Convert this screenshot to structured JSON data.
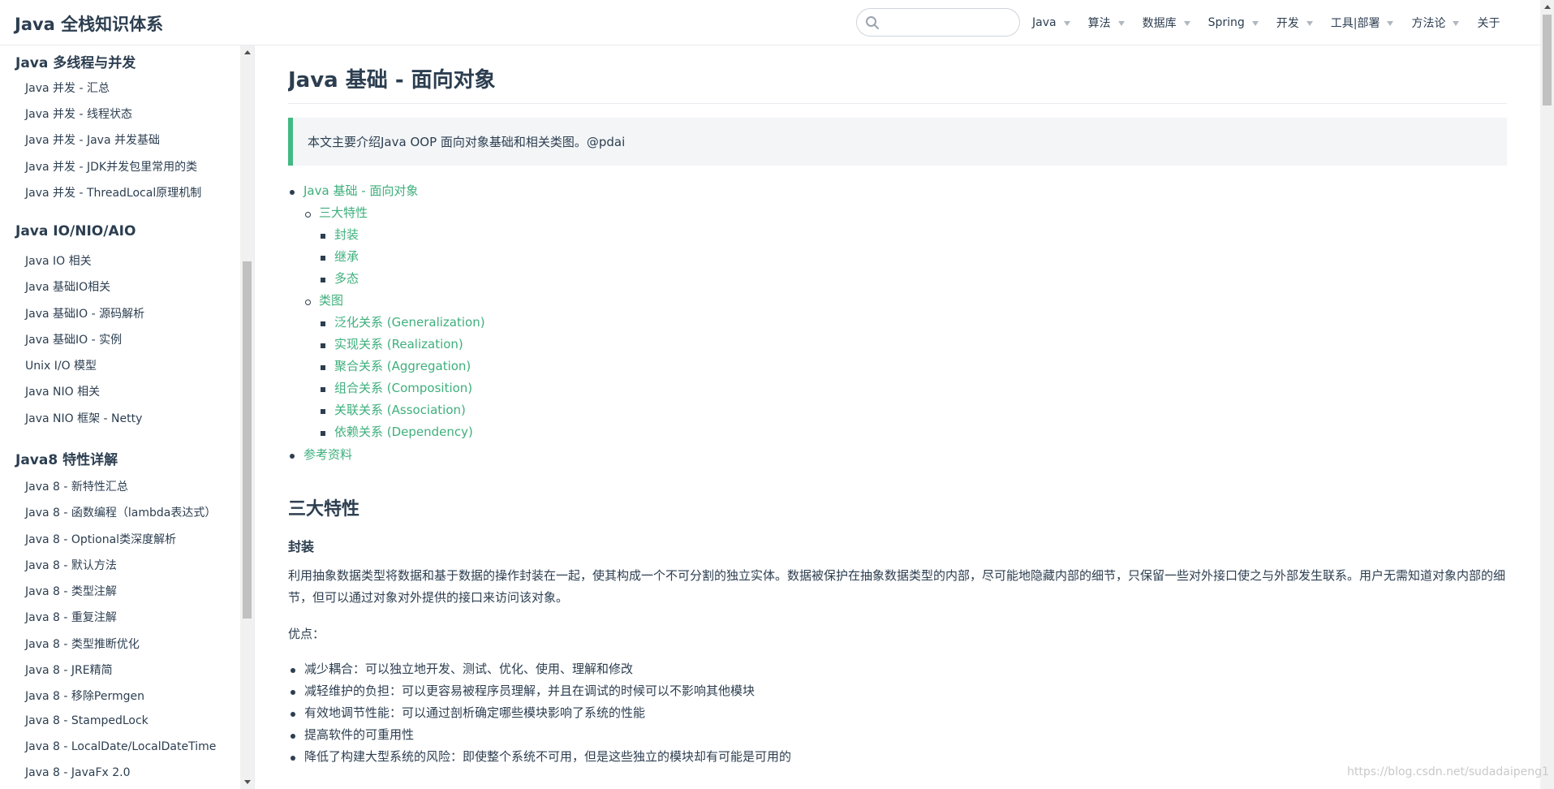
{
  "navbar": {
    "site_name": "Java 全栈知识体系",
    "search_value": "",
    "links": [
      {
        "label": "Java",
        "dropdown": true
      },
      {
        "label": "算法",
        "dropdown": true
      },
      {
        "label": "数据库",
        "dropdown": true
      },
      {
        "label": "Spring",
        "dropdown": true
      },
      {
        "label": "开发",
        "dropdown": true
      },
      {
        "label": "工具|部署",
        "dropdown": true
      },
      {
        "label": "方法论",
        "dropdown": true
      },
      {
        "label": "关于",
        "dropdown": false
      }
    ]
  },
  "sidebar": {
    "groups": [
      {
        "title": "Java 多线程与并发",
        "items": [
          "Java 并发 - 汇总",
          "Java 并发 - 线程状态",
          "Java 并发 - Java 并发基础",
          "Java 并发 - JDK并发包里常用的类",
          "Java 并发 - ThreadLocal原理机制"
        ]
      },
      {
        "title": "Java IO/NIO/AIO",
        "items": [
          "Java IO 相关",
          "Java 基础IO相关",
          "Java 基础IO - 源码解析",
          "Java 基础IO - 实例",
          "Unix I/O 模型",
          "Java NIO 相关",
          "Java NIO 框架 - Netty"
        ]
      },
      {
        "title": "Java8 特性详解",
        "items": [
          "Java 8 - 新特性汇总",
          "Java 8 - 函数编程（lambda表达式）",
          "Java 8 - Optional类深度解析",
          "Java 8 - 默认方法",
          "Java 8 - 类型注解",
          "Java 8 - 重复注解",
          "Java 8 - 类型推断优化",
          "Java 8 - JRE精简",
          "Java 8 - 移除Permgen",
          "Java 8 - StampedLock",
          "Java 8 - LocalDate/LocalDateTime",
          "Java 8 - JavaFx 2.0"
        ]
      }
    ]
  },
  "main": {
    "title": "Java 基础 - 面向对象",
    "tip": "本文主要介绍Java OOP 面向对象基础和相关类图。@pdai",
    "toc": [
      {
        "level": 1,
        "label": "Java 基础 - 面向对象"
      },
      {
        "level": 2,
        "label": "三大特性"
      },
      {
        "level": 3,
        "label": "封装"
      },
      {
        "level": 3,
        "label": "继承"
      },
      {
        "level": 3,
        "label": "多态"
      },
      {
        "level": 2,
        "label": "类图"
      },
      {
        "level": 3,
        "label": "泛化关系 (Generalization)"
      },
      {
        "level": 3,
        "label": "实现关系 (Realization)"
      },
      {
        "level": 3,
        "label": "聚合关系 (Aggregation)"
      },
      {
        "level": 3,
        "label": "组合关系 (Composition)"
      },
      {
        "level": 3,
        "label": "关联关系 (Association)"
      },
      {
        "level": 3,
        "label": "依赖关系 (Dependency)"
      },
      {
        "level": 1,
        "label": "参考资料"
      }
    ],
    "section_title": "三大特性",
    "subsection_title": "封装",
    "paragraph": "利用抽象数据类型将数据和基于数据的操作封装在一起，使其构成一个不可分割的独立实体。数据被保护在抽象数据类型的内部，尽可能地隐藏内部的细节，只保留一些对外接口使之与外部发生联系。用户无需知道对象内部的细节，但可以通过对象对外提供的接口来访问该对象。",
    "advantages_label": "优点：",
    "advantages": [
      "减少耦合：可以独立地开发、测试、优化、使用、理解和修改",
      "减轻维护的负担：可以更容易被程序员理解，并且在调试的时候可以不影响其他模块",
      "有效地调节性能：可以通过剖析确定哪些模块影响了系统的性能",
      "提高软件的可重用性",
      "降低了构建大型系统的风险：即使整个系统不可用，但是这些独立的模块却有可能是可用的"
    ]
  },
  "watermark": "https://blog.csdn.net/sudadaipeng1",
  "colors": {
    "accent": "#3eaf7c",
    "text": "#2c3e50",
    "tip_border": "#42b983",
    "tip_bg": "#f3f5f7"
  }
}
